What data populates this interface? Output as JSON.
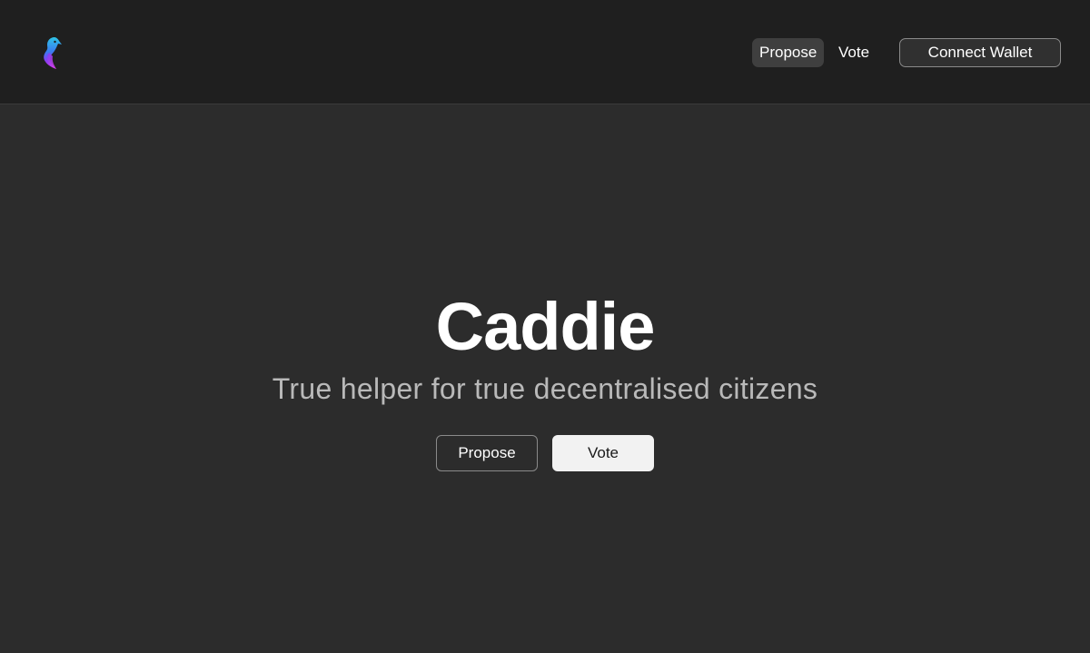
{
  "app": {
    "logo_icon": "bird-logo-icon",
    "brand_colors": [
      "#2ec4e6",
      "#7b3ff2",
      "#d93cf0"
    ]
  },
  "nav": {
    "items": [
      {
        "label": "Propose",
        "active": true
      },
      {
        "label": "Vote",
        "active": false
      }
    ],
    "connect_label": "Connect Wallet"
  },
  "hero": {
    "title": "Caddie",
    "subtitle": "True helper for true decentralised citizens",
    "propose_label": "Propose",
    "vote_label": "Vote"
  },
  "colors": {
    "navbar_bg": "#1f1f1f",
    "page_bg": "#2c2c2c",
    "subtitle": "#b9b9b9",
    "solid_button_bg": "#f2f2f2"
  }
}
